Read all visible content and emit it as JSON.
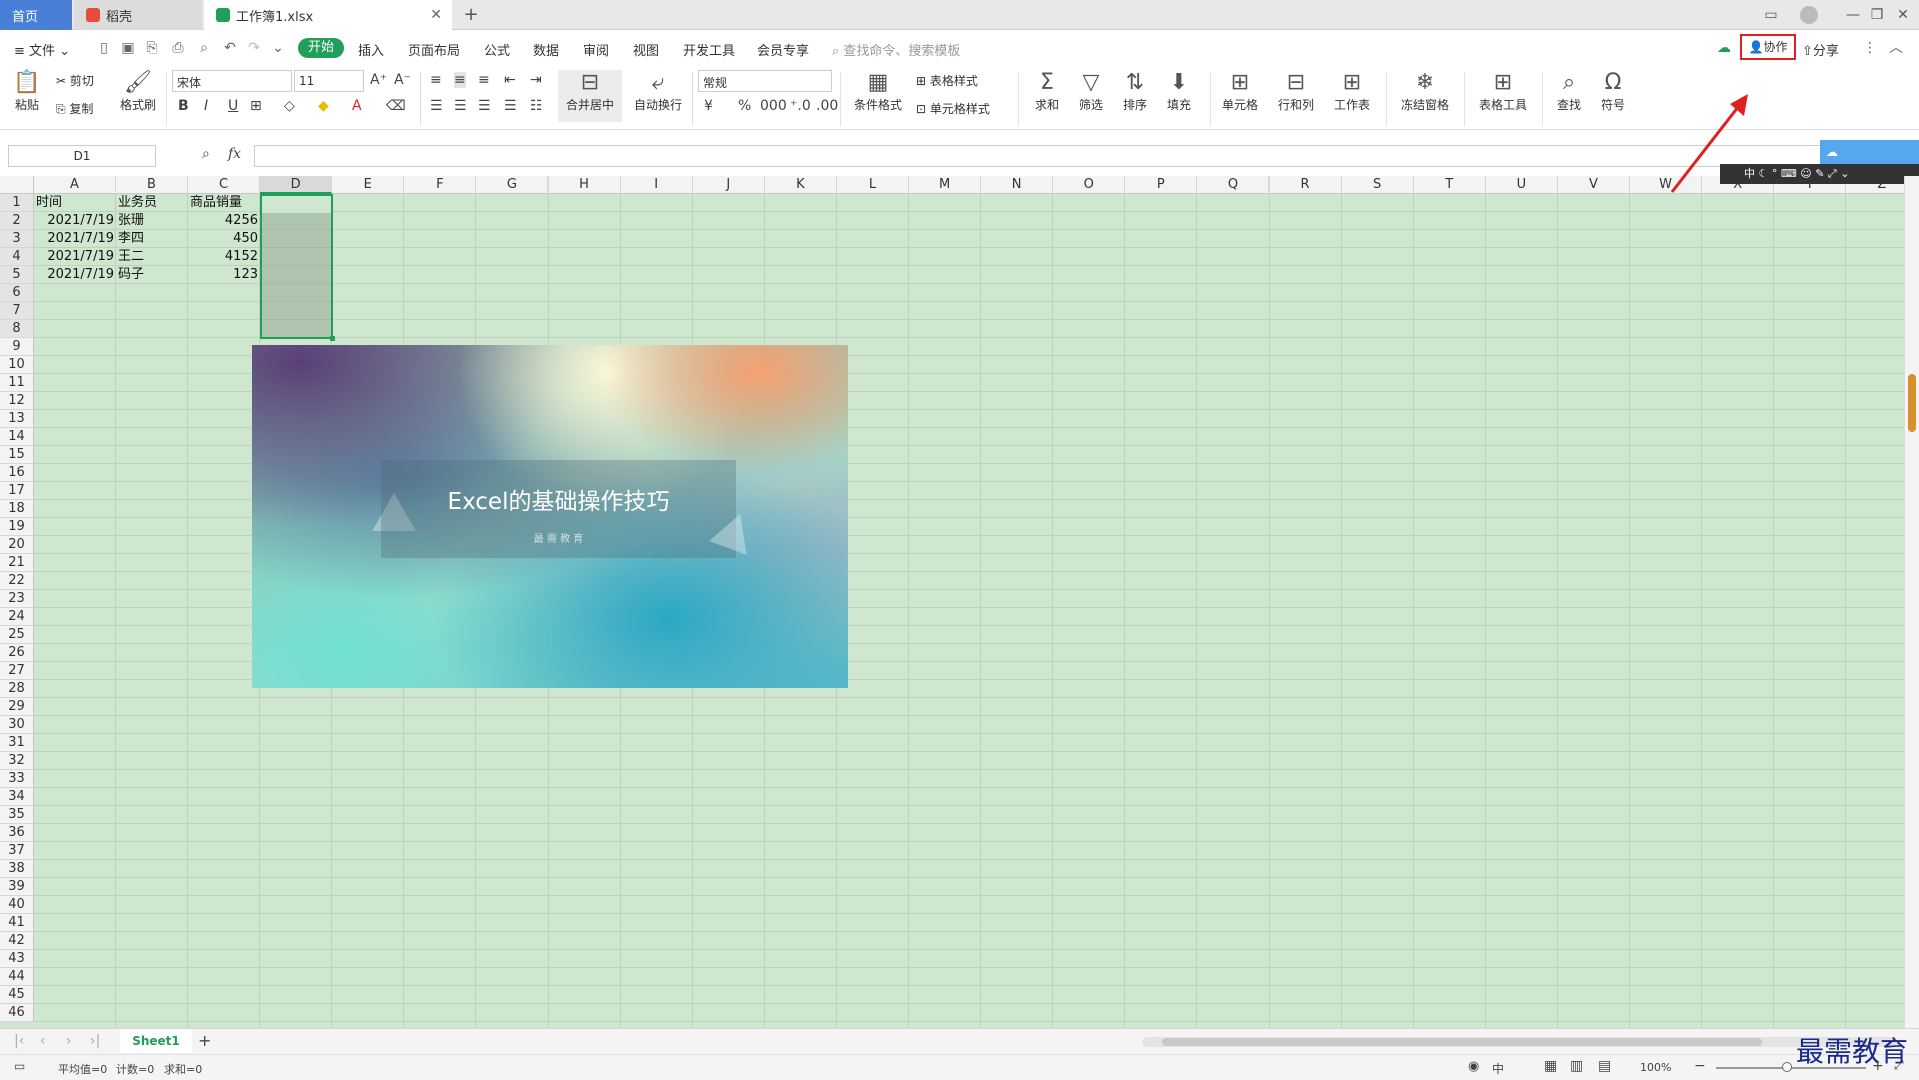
{
  "titlebar": {
    "tabs": [
      {
        "label": "首页"
      },
      {
        "label": "稻壳"
      },
      {
        "label": "工作簿1.xlsx"
      }
    ],
    "new_tab": "+"
  },
  "menubar": {
    "file": "文件",
    "items": [
      "开始",
      "插入",
      "页面布局",
      "公式",
      "数据",
      "审阅",
      "视图",
      "开发工具",
      "会员专享"
    ],
    "search_placeholder": "查找命令、搜索模板",
    "collab": "协作",
    "share": "分享"
  },
  "ribbon": {
    "paste": "粘贴",
    "cut": "剪切",
    "copy": "复制",
    "format_painter": "格式刷",
    "font_name": "宋体",
    "font_size": "11",
    "merge_center": "合并居中",
    "wrap_text": "自动换行",
    "number_format": "常规",
    "cond_format": "条件格式",
    "table_style": "表格样式",
    "cell_style": "单元格样式",
    "sum": "求和",
    "filter": "筛选",
    "sort": "排序",
    "fill": "填充",
    "cells": "单元格",
    "rowcol": "行和列",
    "worksheet": "工作表",
    "freeze": "冻结窗格",
    "table_tools": "表格工具",
    "find": "查找",
    "symbol": "符号"
  },
  "formula_bar": {
    "name_box": "D1",
    "fx": "fx",
    "formula": ""
  },
  "grid": {
    "columns": [
      "A",
      "B",
      "C",
      "D",
      "E",
      "F",
      "G",
      "H",
      "I",
      "J",
      "K",
      "L",
      "M",
      "N",
      "O",
      "P",
      "Q",
      "R",
      "S",
      "T",
      "U",
      "V",
      "W",
      "X",
      "Y",
      "Z"
    ],
    "rows": [
      "1",
      "2",
      "3",
      "4",
      "5",
      "6",
      "7",
      "8",
      "9",
      "10",
      "11",
      "12",
      "13",
      "14",
      "15",
      "16",
      "17",
      "18",
      "19",
      "20",
      "21",
      "22",
      "23",
      "24",
      "25",
      "26",
      "27",
      "28",
      "29",
      "30",
      "31",
      "32",
      "33",
      "34",
      "35",
      "36",
      "37",
      "38",
      "39",
      "40",
      "41",
      "42",
      "43",
      "44",
      "45",
      "46"
    ],
    "headers": [
      "时间",
      "业务员",
      "商品销量"
    ],
    "data": [
      [
        "2021/7/19",
        "张珊",
        "4256"
      ],
      [
        "2021/7/19",
        "李四",
        "450"
      ],
      [
        "2021/7/19",
        "王二",
        "4152"
      ],
      [
        "2021/7/19",
        "码子",
        "123"
      ]
    ]
  },
  "image": {
    "title": "Excel的基础操作技巧",
    "subtitle": "最 需 教 育"
  },
  "sheets": {
    "active": "Sheet1",
    "add": "+"
  },
  "status": {
    "avg": "平均值=0",
    "count": "计数=0",
    "sum": "求和=0",
    "zoom": "100%"
  },
  "watermark": "最需教育",
  "colors": {
    "accent": "#1e9f5a",
    "grid_bg": "#cfe6cf",
    "highlight_red": "#e02020"
  }
}
